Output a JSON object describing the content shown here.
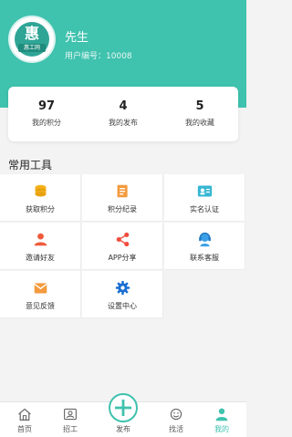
{
  "profile": {
    "avatar_char": "惠",
    "avatar_tag": "惠工网",
    "name": "先生",
    "id_label": "用户编号：",
    "id_value": "10008"
  },
  "stats": [
    {
      "value": "97",
      "label": "我的积分"
    },
    {
      "value": "4",
      "label": "我的发布"
    },
    {
      "value": "5",
      "label": "我的收藏"
    }
  ],
  "tools_title": "常用工具",
  "tools": [
    {
      "label": "获取积分",
      "icon": "coins-icon"
    },
    {
      "label": "积分纪录",
      "icon": "record-icon"
    },
    {
      "label": "实名认证",
      "icon": "id-card-icon"
    },
    {
      "label": "邀请好友",
      "icon": "invite-user-icon"
    },
    {
      "label": "APP分享",
      "icon": "share-icon"
    },
    {
      "label": "联系客服",
      "icon": "customer-service-icon"
    },
    {
      "label": "意见反馈",
      "icon": "feedback-mail-icon"
    },
    {
      "label": "设置中心",
      "icon": "settings-gear-icon"
    }
  ],
  "tabbar": [
    {
      "label": "首页",
      "icon": "home-icon"
    },
    {
      "label": "招工",
      "icon": "recruit-icon"
    },
    {
      "label": "发布",
      "icon": "plus-icon"
    },
    {
      "label": "找活",
      "icon": "find-job-icon"
    },
    {
      "label": "我的",
      "icon": "profile-icon"
    }
  ],
  "colors": {
    "accent": "#3fc2ae",
    "active_tab": "#3fc2ae"
  }
}
